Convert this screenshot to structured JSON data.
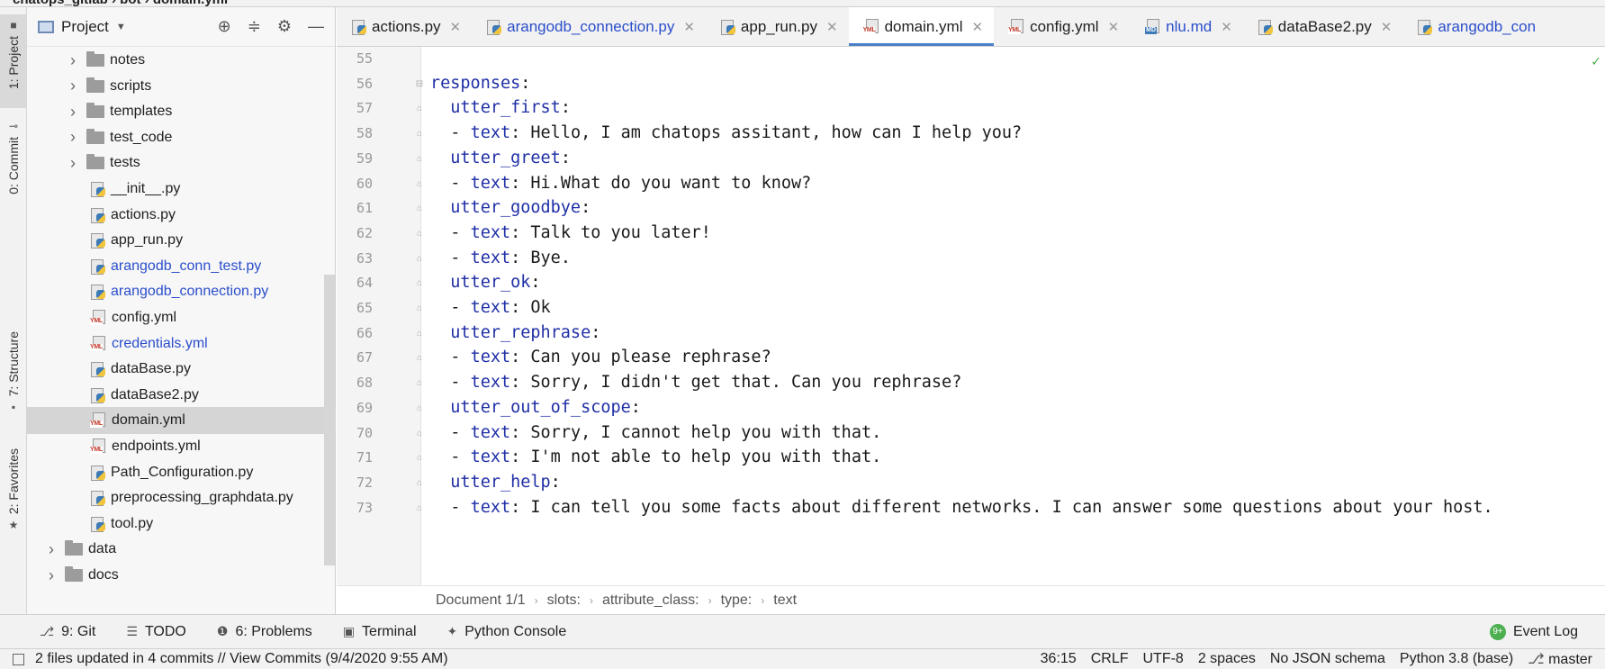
{
  "breadcrumb": {
    "text": "chatops_gitlab  ›  bot  ›  domain.yml"
  },
  "left_stripe": {
    "tabs": [
      {
        "label": "1: Project",
        "active": true,
        "icon": "folder-icon"
      },
      {
        "label": "0: Commit",
        "active": false,
        "icon": "commit-icon"
      },
      {
        "label": "7: Structure",
        "active": false,
        "icon": "structure-icon"
      },
      {
        "label": "2: Favorites",
        "active": false,
        "icon": "star-icon"
      }
    ]
  },
  "project_panel": {
    "title": "Project",
    "items": [
      {
        "label": "notes",
        "type": "folder",
        "indent": 1,
        "collapsed": true
      },
      {
        "label": "scripts",
        "type": "folder",
        "indent": 1,
        "collapsed": true
      },
      {
        "label": "templates",
        "type": "folder",
        "indent": 1,
        "collapsed": true
      },
      {
        "label": "test_code",
        "type": "folder",
        "indent": 1,
        "collapsed": true
      },
      {
        "label": "tests",
        "type": "folder",
        "indent": 1,
        "collapsed": true
      },
      {
        "label": "__init__.py",
        "type": "py",
        "indent": 2
      },
      {
        "label": "actions.py",
        "type": "py",
        "indent": 2
      },
      {
        "label": "app_run.py",
        "type": "py",
        "indent": 2
      },
      {
        "label": "arangodb_conn_test.py",
        "type": "py",
        "indent": 2,
        "modified": true
      },
      {
        "label": "arangodb_connection.py",
        "type": "py",
        "indent": 2,
        "modified": true
      },
      {
        "label": "config.yml",
        "type": "yml",
        "indent": 2
      },
      {
        "label": "credentials.yml",
        "type": "yml",
        "indent": 2,
        "modified": true
      },
      {
        "label": "dataBase.py",
        "type": "py",
        "indent": 2
      },
      {
        "label": "dataBase2.py",
        "type": "py",
        "indent": 2
      },
      {
        "label": "domain.yml",
        "type": "yml",
        "indent": 2,
        "selected": true
      },
      {
        "label": "endpoints.yml",
        "type": "yml",
        "indent": 2
      },
      {
        "label": "Path_Configuration.py",
        "type": "py",
        "indent": 2
      },
      {
        "label": "preprocessing_graphdata.py",
        "type": "py",
        "indent": 2
      },
      {
        "label": "tool.py",
        "type": "py",
        "indent": 2
      },
      {
        "label": "data",
        "type": "folder",
        "indent": 0,
        "collapsed": true
      },
      {
        "label": "docs",
        "type": "folder",
        "indent": 0,
        "collapsed": true
      }
    ]
  },
  "editor_tabs": [
    {
      "label": "actions.py",
      "type": "py",
      "modified": false
    },
    {
      "label": "arangodb_connection.py",
      "type": "py",
      "modified": true
    },
    {
      "label": "app_run.py",
      "type": "py",
      "modified": false
    },
    {
      "label": "domain.yml",
      "type": "yml",
      "modified": false,
      "active": true
    },
    {
      "label": "config.yml",
      "type": "yml",
      "modified": false
    },
    {
      "label": "nlu.md",
      "type": "md",
      "modified": true
    },
    {
      "label": "dataBase2.py",
      "type": "py",
      "modified": false
    },
    {
      "label": "arangodb_con",
      "type": "py",
      "modified": true
    }
  ],
  "code_lines": [
    {
      "n": "55",
      "indent": "",
      "key": "",
      "rest": ""
    },
    {
      "n": "56",
      "indent": "",
      "key": "responses",
      "rest": ":"
    },
    {
      "n": "57",
      "indent": "  ",
      "key": "utter_first",
      "rest": ":"
    },
    {
      "n": "58",
      "indent": "  - ",
      "key": "text",
      "rest": ": Hello, I am chatops assitant, how can I help you?"
    },
    {
      "n": "59",
      "indent": "  ",
      "key": "utter_greet",
      "rest": ":"
    },
    {
      "n": "60",
      "indent": "  - ",
      "key": "text",
      "rest": ": Hi.What do you want to know?"
    },
    {
      "n": "61",
      "indent": "  ",
      "key": "utter_goodbye",
      "rest": ":"
    },
    {
      "n": "62",
      "indent": "  - ",
      "key": "text",
      "rest": ": Talk to you later!"
    },
    {
      "n": "63",
      "indent": "  - ",
      "key": "text",
      "rest": ": Bye."
    },
    {
      "n": "64",
      "indent": "  ",
      "key": "utter_ok",
      "rest": ":"
    },
    {
      "n": "65",
      "indent": "  - ",
      "key": "text",
      "rest": ": Ok"
    },
    {
      "n": "66",
      "indent": "  ",
      "key": "utter_rephrase",
      "rest": ":"
    },
    {
      "n": "67",
      "indent": "  - ",
      "key": "text",
      "rest": ": Can you please rephrase?"
    },
    {
      "n": "68",
      "indent": "  - ",
      "key": "text",
      "rest": ": Sorry, I didn't get that. Can you rephrase?"
    },
    {
      "n": "69",
      "indent": "  ",
      "key": "utter_out_of_scope",
      "rest": ":"
    },
    {
      "n": "70",
      "indent": "  - ",
      "key": "text",
      "rest": ": Sorry, I cannot help you with that."
    },
    {
      "n": "71",
      "indent": "  - ",
      "key": "text",
      "rest": ": I'm not able to help you with that."
    },
    {
      "n": "72",
      "indent": "  ",
      "key": "utter_help",
      "rest": ":"
    },
    {
      "n": "73",
      "indent": "  - ",
      "key": "text",
      "rest": ": I can tell you some facts about different networks. I can answer some questions about your host."
    }
  ],
  "editor_breadcrumb": [
    "Document 1/1",
    "slots:",
    "attribute_class:",
    "type:",
    "text"
  ],
  "bottom_tools": [
    {
      "label": "9: Git",
      "icon": "git-icon"
    },
    {
      "label": "TODO",
      "icon": "list-icon"
    },
    {
      "label": "6: Problems",
      "icon": "problems-icon"
    },
    {
      "label": "Terminal",
      "icon": "terminal-icon"
    },
    {
      "label": "Python Console",
      "icon": "python-icon"
    }
  ],
  "event_log": {
    "label": "Event Log",
    "badge": "9+"
  },
  "status_bar": {
    "message": "2 files updated in 4 commits // View Commits (9/4/2020 9:55 AM)",
    "position": "36:15",
    "line_sep": "CRLF",
    "encoding": "UTF-8",
    "indent": "2 spaces",
    "schema": "No JSON schema",
    "interpreter": "Python 3.8 (base)",
    "branch": "master"
  },
  "colors": {
    "accent": "#4a7fc7",
    "key": "#1f2fa6",
    "modified": "#2b4ecb",
    "selection": "#d5d5d5"
  }
}
